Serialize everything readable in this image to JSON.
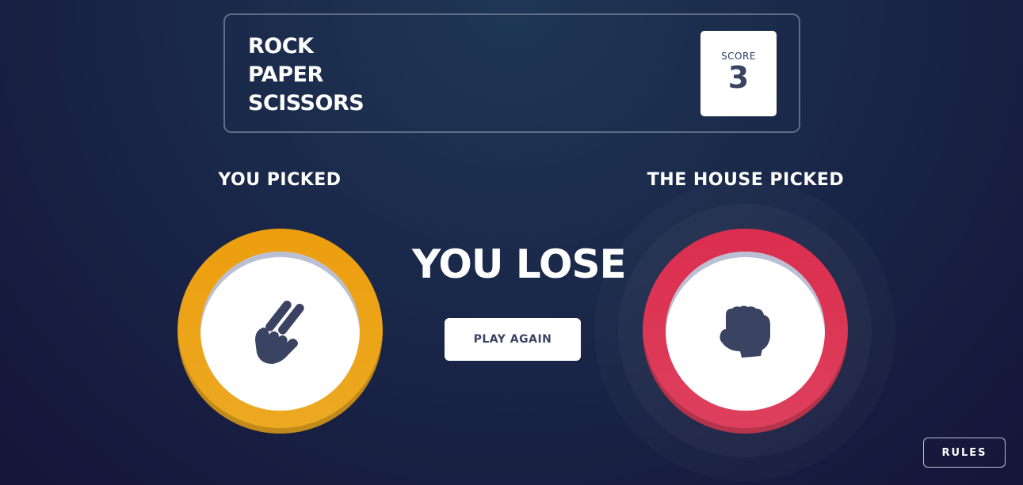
{
  "header": {
    "title_lines": [
      "ROCK",
      "PAPER",
      "SCISSORS"
    ],
    "score_label": "SCORE",
    "score_value": "3"
  },
  "player": {
    "label": "YOU PICKED",
    "choice": "scissors",
    "icon": "scissors-hand-icon",
    "ring_color": "#eca922"
  },
  "house": {
    "label": "THE HOUSE PICKED",
    "choice": "rock",
    "icon": "rock-fist-icon",
    "ring_color": "#dd405d"
  },
  "result": {
    "text": "YOU LOSE",
    "play_again_label": "PLAY AGAIN"
  },
  "rules_label": "RULES",
  "colors": {
    "background_top": "#1f3756",
    "background_bottom": "#141539",
    "dark_text": "#3b4363",
    "header_outline": "#606e85"
  }
}
